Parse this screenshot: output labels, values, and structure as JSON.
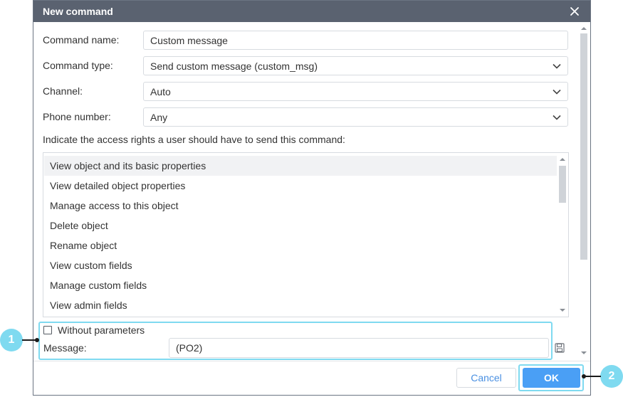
{
  "dialog": {
    "title": "New command",
    "close_icon": "close-icon"
  },
  "form": {
    "command_name": {
      "label": "Command name:",
      "value": "Custom message"
    },
    "command_type": {
      "label": "Command type:",
      "value": "Send custom message (custom_msg)"
    },
    "channel": {
      "label": "Channel:",
      "value": "Auto"
    },
    "phone_number": {
      "label": "Phone number:",
      "value": "Any"
    }
  },
  "access_rights": {
    "label": "Indicate the access rights a user should have to send this command:",
    "items": [
      "View object and its basic properties",
      "View detailed object properties",
      "Manage access to this object",
      "Delete object",
      "Rename object",
      "View custom fields",
      "Manage custom fields",
      "View admin fields"
    ],
    "selected_index": 0
  },
  "parameters": {
    "without_parameters_label": "Without parameters",
    "without_parameters_checked": false,
    "message_label": "Message:",
    "message_value": "(PO2)",
    "save_icon": "save-icon"
  },
  "buttons": {
    "cancel": "Cancel",
    "ok": "OK"
  },
  "callouts": [
    "1",
    "2"
  ],
  "colors": {
    "titlebar": "#5a6270",
    "accent": "#4a9ff5",
    "callout": "#7fdaf0"
  }
}
